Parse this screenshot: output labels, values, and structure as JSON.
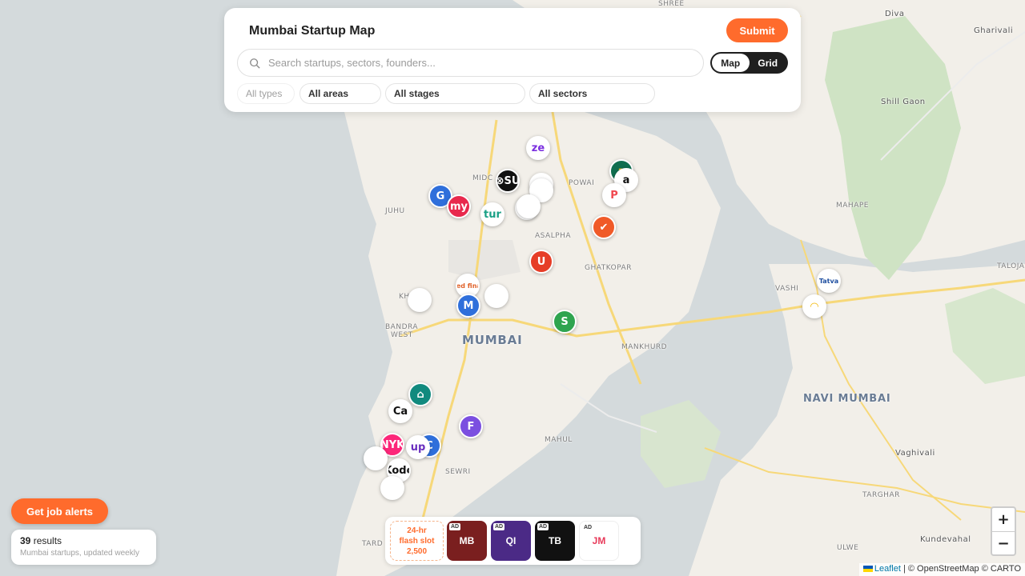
{
  "panel": {
    "title": "Mumbai Startup Map",
    "submit_label": "Submit",
    "search_placeholder": "Search startups, sectors, founders...",
    "view_toggle": {
      "options": [
        "Map",
        "Grid"
      ],
      "active": "Map"
    },
    "filters": {
      "type": "All types",
      "area": "All areas",
      "stage": "All stages",
      "sector": "All sectors"
    }
  },
  "map_labels": {
    "shree": "SHREE",
    "diva": "Diva",
    "gharivali": "Gharivali",
    "shill_gaon": "Shill Gaon",
    "midc": "MIDC",
    "powai": "POWAI",
    "juhu": "JUHU",
    "asalpha": "ASALPHA",
    "ghatkopar": "GHATKOPAR",
    "mahape": "MAHAPE",
    "vashi": "VASHI",
    "taloja": "TALOJA",
    "kh": "KH",
    "bandra": "BANDRA",
    "west": "WEST",
    "mumbai": "MUMBAI",
    "mankhurd": "MANKHURD",
    "navi_mumbai": "NAVI MUMBAI",
    "mahul": "MAHUL",
    "sewri": "SEWRI",
    "vaghivali": "Vaghivali",
    "targhar": "TARGHAR",
    "ulwe": "ULWE",
    "kundevahal": "Kundevahal",
    "tard": "TARD"
  },
  "markers": [
    {
      "name": "ze",
      "text": "ze",
      "bg": "#ffffff",
      "fg": "#7b2fe0"
    },
    {
      "name": "xsu",
      "text": "⊗SU",
      "bg": "#111111",
      "fg": "#ffffff"
    },
    {
      "name": "red-arc",
      "text": "",
      "bg": "#ffffff",
      "fg": "#e43d3d"
    },
    {
      "name": "blue-logo",
      "text": "",
      "bg": "#ffffff",
      "fg": "#2c7fd8"
    },
    {
      "name": "g",
      "text": "G",
      "bg": "#2f6fdb",
      "fg": "#ffffff"
    },
    {
      "name": "my",
      "text": "my",
      "bg": "#e8294d",
      "fg": "#ffffff"
    },
    {
      "name": "tur",
      "text": "tur",
      "bg": "#ffffff",
      "fg": "#1aa086"
    },
    {
      "name": "edu",
      "text": "edı",
      "bg": "#ffffff",
      "fg": "#555555"
    },
    {
      "name": "teal-ring",
      "text": "",
      "bg": "#ffffff",
      "fg": "#1aa086"
    },
    {
      "name": "green-a",
      "text": "a",
      "bg": "#0f6e4f",
      "fg": "#f6c431"
    },
    {
      "name": "a-black",
      "text": "a",
      "bg": "#ffffff",
      "fg": "#111111"
    },
    {
      "name": "p",
      "text": "P",
      "bg": "#ffffff",
      "fg": "#f0474f"
    },
    {
      "name": "check",
      "text": "✔",
      "bg": "#f05a28",
      "fg": "#ffffff"
    },
    {
      "name": "u",
      "text": "U",
      "bg": "#e63d27",
      "fg": "#ffffff"
    },
    {
      "name": "incred",
      "text": "InCred finance",
      "bg": "#ffffff",
      "fg": "#e0622a"
    },
    {
      "name": "blank-1",
      "text": "",
      "bg": "#ffffff",
      "fg": "#ffffff"
    },
    {
      "name": "m",
      "text": "M",
      "bg": "#2f6fdb",
      "fg": "#ffffff"
    },
    {
      "name": "blank-2",
      "text": "",
      "bg": "#ffffff",
      "fg": "#ffffff"
    },
    {
      "name": "s",
      "text": "S",
      "bg": "#2ea44f",
      "fg": "#ffffff"
    },
    {
      "name": "teal-house",
      "text": "⌂",
      "bg": "#118a7e",
      "fg": "#ffffff"
    },
    {
      "name": "ca",
      "text": "Ca",
      "bg": "#ffffff",
      "fg": "#111111"
    },
    {
      "name": "f",
      "text": "F",
      "bg": "#7b4fe0",
      "fg": "#ffffff"
    },
    {
      "name": "nykaa",
      "text": "NYK",
      "bg": "#fc2779",
      "fg": "#ffffff"
    },
    {
      "name": "c-blue",
      "text": "C",
      "bg": "#2f6fdb",
      "fg": "#ffffff"
    },
    {
      "name": "up",
      "text": "up",
      "bg": "#ffffff",
      "fg": "#6a2fbf"
    },
    {
      "name": "blank-3",
      "text": "",
      "bg": "#ffffff",
      "fg": "#ffffff"
    },
    {
      "name": "kodo",
      "text": "Kodo",
      "bg": "#ffffff",
      "fg": "#111111"
    },
    {
      "name": "blank-4",
      "text": "",
      "bg": "#ffffff",
      "fg": "#ffffff"
    },
    {
      "name": "tatva",
      "text": "Tatva",
      "bg": "#ffffff",
      "fg": "#1f4fa0"
    },
    {
      "name": "yellow-swirl",
      "text": "◠",
      "bg": "#ffffff",
      "fg": "#f2b705"
    }
  ],
  "job_alerts_label": "Get job alerts",
  "results": {
    "count": "39",
    "count_label": " results",
    "subtitle": "Mumbai startups, updated weekly"
  },
  "ads": {
    "flash_line1": "24-hr",
    "flash_line2": "flash slot",
    "flash_line3": "2,500",
    "tag": "AD",
    "items": [
      {
        "label": "MB",
        "bg": "#7a1f1f"
      },
      {
        "label": "QI",
        "bg": "#4b2a86"
      },
      {
        "label": "TB",
        "bg": "#111111"
      },
      {
        "label": "JM",
        "bg": "#ffffff"
      }
    ]
  },
  "zoom": {
    "in": "+",
    "out": "−"
  },
  "attribution": {
    "leaflet": "Leaflet",
    "rest": " | © OpenStreetMap © CARTO"
  }
}
